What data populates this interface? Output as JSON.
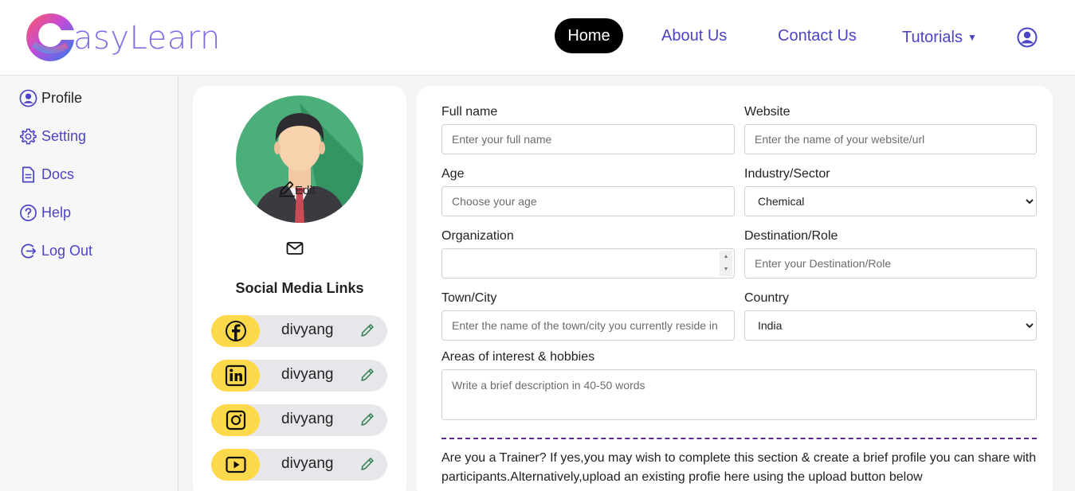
{
  "brand": {
    "name": "asyLearn"
  },
  "nav": {
    "home": "Home",
    "about": "About Us",
    "contact": "Contact Us",
    "tutorials": "Tutorials",
    "caret": "▼"
  },
  "sidebar": {
    "items": [
      {
        "label": "Profile",
        "icon": "user-circle-icon"
      },
      {
        "label": "Setting",
        "icon": "gear-icon"
      },
      {
        "label": "Docs",
        "icon": "document-icon"
      },
      {
        "label": "Help",
        "icon": "help-icon"
      },
      {
        "label": "Log Out",
        "icon": "logout-icon"
      }
    ]
  },
  "profile": {
    "edit_label": "Edit",
    "social_title": "Social Media Links",
    "social": [
      {
        "network": "facebook-icon",
        "handle": "divyang"
      },
      {
        "network": "linkedin-icon",
        "handle": "divyang"
      },
      {
        "network": "instagram-icon",
        "handle": "divyang"
      },
      {
        "network": "youtube-icon",
        "handle": "divyang"
      }
    ]
  },
  "form": {
    "full_name": {
      "label": "Full name",
      "placeholder": "Enter your full name"
    },
    "website": {
      "label": "Website",
      "placeholder": "Enter the name of your website/url"
    },
    "age": {
      "label": "Age",
      "placeholder": "Choose your age"
    },
    "industry": {
      "label": "Industry/Sector",
      "value": "Chemical"
    },
    "organization": {
      "label": "Organization",
      "value": ""
    },
    "destination": {
      "label": "Destination/Role",
      "placeholder": "Enter your Destination/Role"
    },
    "town": {
      "label": "Town/City",
      "placeholder": "Enter the name of the town/city you currently reside in"
    },
    "country": {
      "label": "Country",
      "value": "India"
    },
    "interests": {
      "label": "Areas of interest & hobbies",
      "placeholder": "Write a brief description in 40-50 words"
    }
  },
  "trainer_note": "Are you a Trainer? If yes,you may wish to complete this section & create a brief profile you can share with participants.Alternatively,upload an existing profie here using the upload button below",
  "colors": {
    "accent": "#4b44c6",
    "badge": "#fbd94a",
    "divider": "#5a2a8a"
  }
}
